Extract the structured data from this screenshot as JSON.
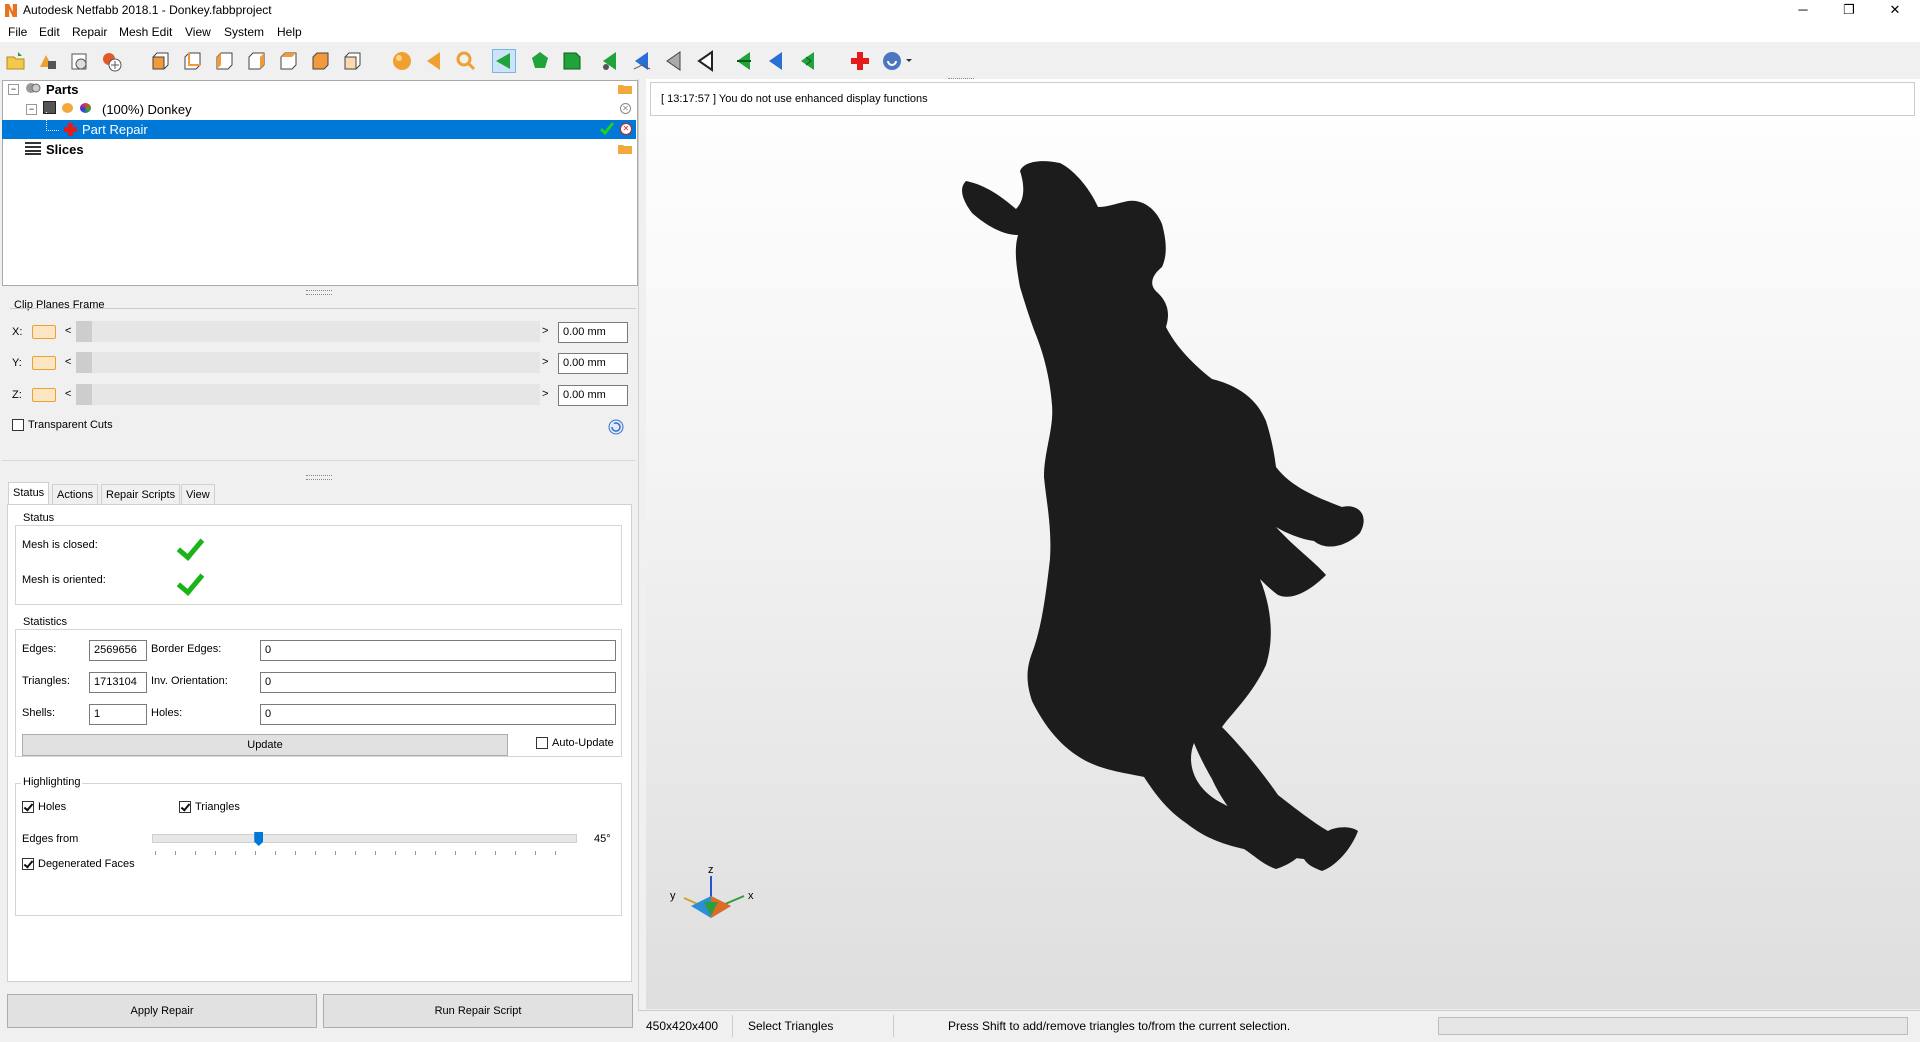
{
  "window": {
    "title": "Autodesk Netfabb 2018.1 - Donkey.fabbproject",
    "minimize": "─",
    "restore": "❐",
    "close": "✕"
  },
  "menu": [
    "File",
    "Edit",
    "Repair",
    "Mesh Edit",
    "View",
    "System",
    "Help"
  ],
  "toolbar": {
    "icons": [
      "open-project-icon",
      "add-part-icon",
      "add-part-2-icon",
      "new-part-icon",
      "view-front-icon",
      "view-back-icon",
      "view-left-icon",
      "view-right-icon",
      "view-top-icon",
      "view-bottom-icon",
      "view-iso-icon",
      "sphere-icon",
      "arrow-icon",
      "zoom-icon",
      "select-triangles-icon",
      "select-surface-icon",
      "select-shell-icon",
      "select-edge-icon",
      "select-plane-icon",
      "select-region-icon",
      "select-all-icon",
      "invert-icon",
      "deselect-icon",
      "extend-icon",
      "repair-icon",
      "help-icon"
    ]
  },
  "tree": {
    "parts_label": "Parts",
    "donkey_label": "(100%) Donkey",
    "repair_label": "Part Repair",
    "slices_label": "Slices"
  },
  "clip": {
    "title": "Clip Planes Frame",
    "x_label": "X:",
    "y_label": "Y:",
    "z_label": "Z:",
    "x_value": "0.00 mm",
    "y_value": "0.00 mm",
    "z_value": "0.00 mm",
    "left_arrow": "<",
    "right_arrow": ">",
    "transparent_label": "Transparent Cuts"
  },
  "tabs": [
    "Status",
    "Actions",
    "Repair Scripts",
    "View"
  ],
  "status": {
    "title": "Status",
    "closed_label": "Mesh is closed:",
    "oriented_label": "Mesh is oriented:",
    "closed": true,
    "oriented": true
  },
  "statistics": {
    "title": "Statistics",
    "edges_label": "Edges:",
    "edges": "2569656",
    "triangles_label": "Triangles:",
    "triangles": "1713104",
    "shells_label": "Shells:",
    "shells": "1",
    "border_label": "Border Edges:",
    "border": "0",
    "inv_label": "Inv. Orientation:",
    "inv": "0",
    "holes_label": "Holes:",
    "holes": "0",
    "update_label": "Update",
    "auto_update_label": "Auto-Update"
  },
  "highlighting": {
    "title": "Highlighting",
    "holes_label": "Holes",
    "holes_checked": true,
    "triangles_label": "Triangles",
    "triangles_checked": true,
    "edges_from_label": "Edges from",
    "edges_value": "45°",
    "slider_fraction": 0.25,
    "degenerated_label": "Degenerated Faces",
    "degenerated_checked": true
  },
  "buttons": {
    "apply": "Apply Repair",
    "run_script": "Run Repair Script"
  },
  "viewport": {
    "message": "[ 13:17:57 ] You do not use enhanced display functions",
    "axis_x": "x",
    "axis_y": "y",
    "axis_z": "z"
  },
  "statusbar": {
    "dims": "450x420x400",
    "mode": "Select Triangles",
    "hint": "Press Shift to add/remove triangles to/from the current selection."
  }
}
